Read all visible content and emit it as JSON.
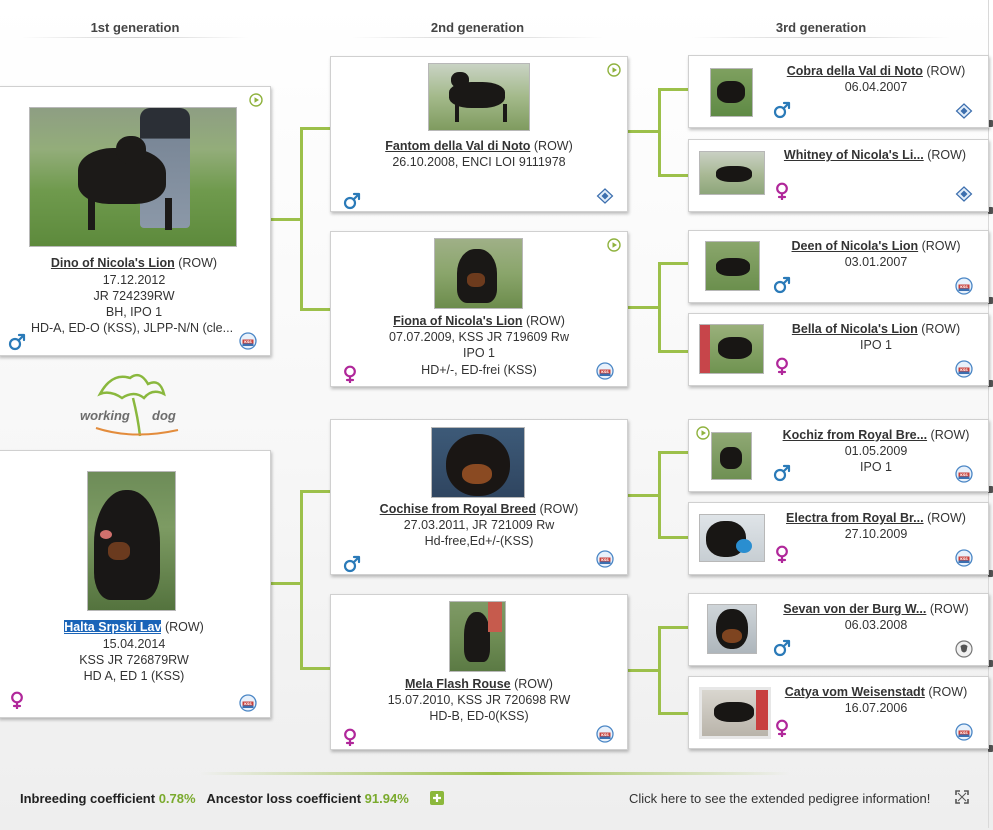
{
  "headers": {
    "gen1": "1st generation",
    "gen2": "2nd generation",
    "gen3": "3rd generation"
  },
  "logo": {
    "text_1": "working",
    "text_2": "dog"
  },
  "colors": {
    "accent_green": "#9cc04a",
    "male_blue": "#2a7ab8",
    "female_magenta": "#b0279a",
    "selected_bg": "#1a64b8"
  },
  "dogs": {
    "dino": {
      "name": "Dino of Nicola's Lion",
      "reg": "(ROW)",
      "lines": [
        "17.12.2012",
        "JR 724239RW",
        "BH, IPO 1",
        "HD-A, ED-O (KSS), JLPP-N/N (cle..."
      ]
    },
    "halta": {
      "name": "Halta Srpski Lav",
      "reg": "(ROW)",
      "lines": [
        "15.04.2014",
        "KSS JR 726879RW",
        "HD A, ED 1 (KSS)"
      ]
    },
    "fantom": {
      "name": "Fantom della Val di Noto",
      "reg": "(ROW)",
      "lines": [
        "26.10.2008, ENCI LOI 9111978"
      ]
    },
    "fiona": {
      "name": "Fiona of Nicola's Lion",
      "reg": "(ROW)",
      "lines": [
        "07.07.2009, KSS JR 719609 Rw",
        "IPO 1",
        "HD+/-, ED-frei (KSS)"
      ]
    },
    "cochise": {
      "name": "Cochise from Royal Breed",
      "reg": "(ROW)",
      "lines": [
        "27.03.2011, JR 721009 Rw",
        "Hd-free,Ed+/-(KSS)"
      ]
    },
    "mela": {
      "name": "Mela Flash Rouse",
      "reg": "(ROW)",
      "lines": [
        "15.07.2010, KSS JR 720698 RW",
        "HD-B, ED-0(KSS)"
      ]
    },
    "cobra": {
      "name": "Cobra della Val di Noto",
      "reg": "(ROW)",
      "lines": [
        "06.04.2007"
      ]
    },
    "whitney": {
      "name": "Whitney of Nicola's Li...",
      "reg": "(ROW)",
      "lines": []
    },
    "deen": {
      "name": "Deen of Nicola's Lion",
      "reg": "(ROW)",
      "lines": [
        "03.01.2007"
      ]
    },
    "bella": {
      "name": "Bella of Nicola's Lion",
      "reg": "(ROW)",
      "lines": [
        "IPO 1"
      ]
    },
    "kochiz": {
      "name": "Kochiz from Royal Bre...",
      "reg": "(ROW)",
      "lines": [
        "01.05.2009",
        "IPO 1"
      ]
    },
    "electra": {
      "name": "Electra from Royal Br...",
      "reg": "(ROW)",
      "lines": [
        "27.10.2009"
      ]
    },
    "sevan": {
      "name": "Sevan von der Burg W...",
      "reg": "(ROW)",
      "lines": [
        "06.03.2008"
      ]
    },
    "catya": {
      "name": "Catya vom Weisenstadt",
      "reg": "(ROW)",
      "lines": [
        "16.07.2006"
      ]
    }
  },
  "footer": {
    "inbreeding_label": "Inbreeding coefficient",
    "inbreeding_value": "0.78%",
    "ancestor_label": "Ancestor loss coefficient",
    "ancestor_value": "91.94%",
    "extended_link": "Click here to see the extended pedigree information!"
  }
}
